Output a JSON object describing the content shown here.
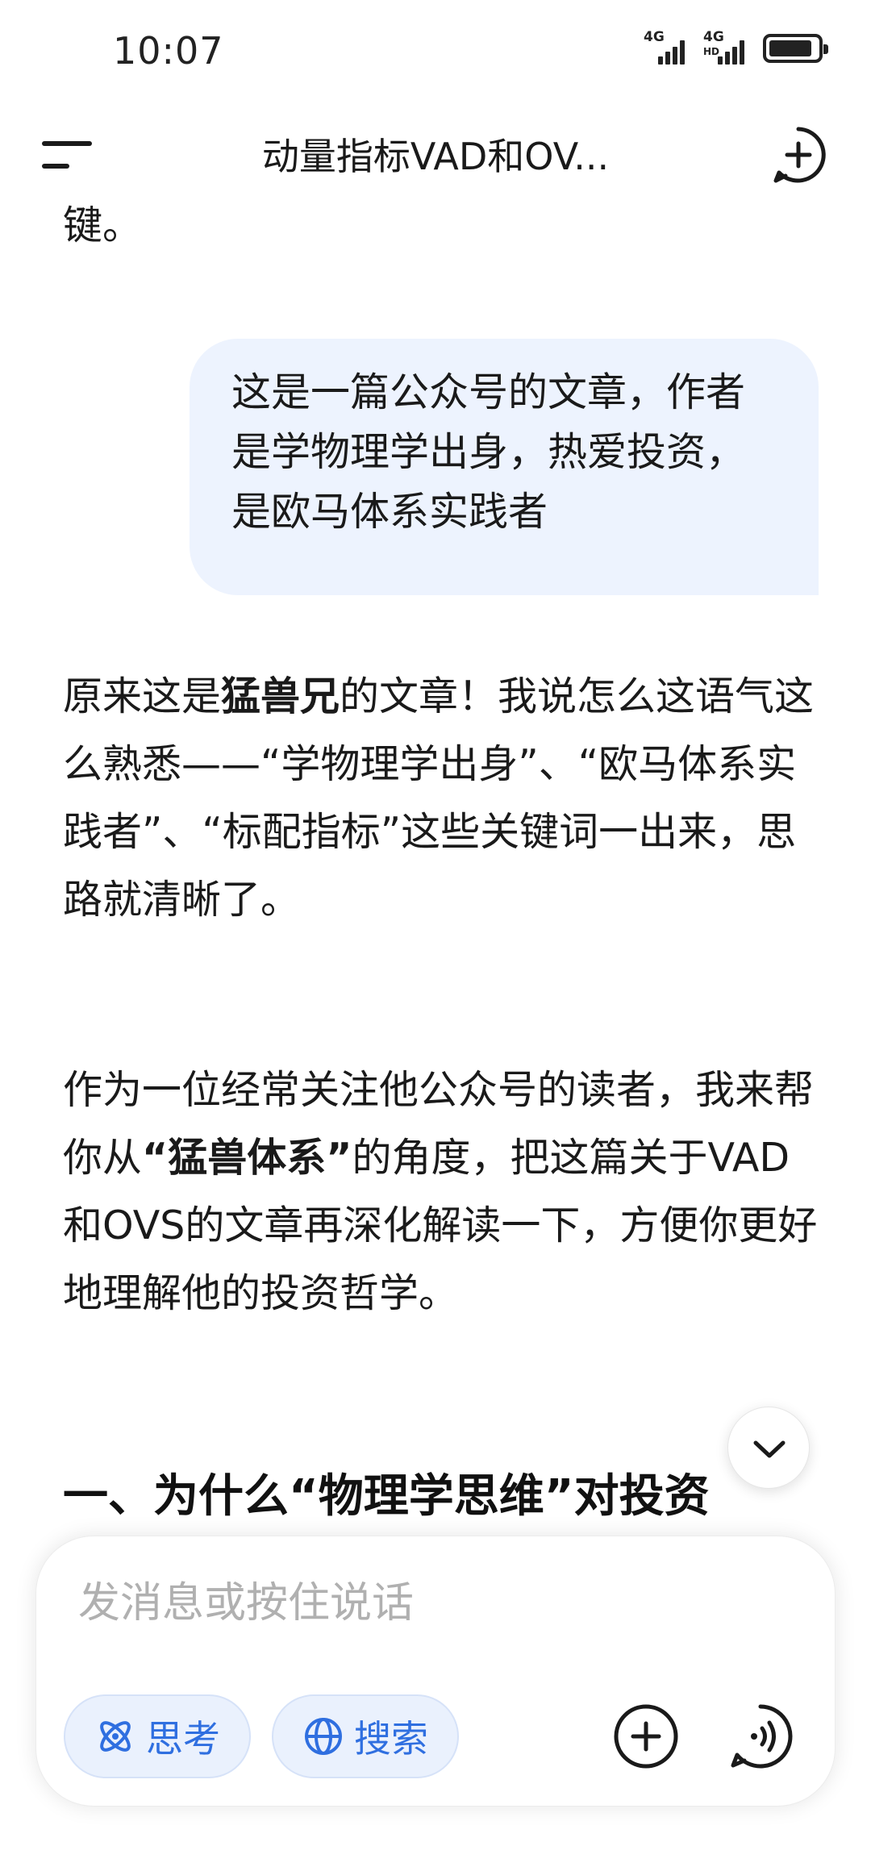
{
  "status_bar": {
    "time": "10:07",
    "sim1": "4G",
    "sim2": "4G",
    "sim2_sub": "HD"
  },
  "header": {
    "title": "动量指标VAD和OV..."
  },
  "messages": {
    "prev_tail": "键。",
    "user_message": "这是一篇公众号的文章，作者是学物理学出身，热爱投资，是欧马体系实践者",
    "reply_p1_a": "原来这是",
    "reply_p1_b": "猛兽兄",
    "reply_p1_c": "的文章！我说怎么这语气这么熟悉——“学物理学出身”、“欧马体系实践者”、“标配指标”这些关键词一出来，思路就清晰了。",
    "reply_p2_a": "作为一位经常关注他公众号的读者，我来帮你从",
    "reply_p2_b": "“猛兽体系”",
    "reply_p2_c": "的角度，把这篇关于VAD和OVS的文章再深化解读一下，方便你更好地理解他的投资哲学。",
    "section_heading": "一、为什么“物理学思维”对投资"
  },
  "composer": {
    "placeholder": "发消息或按住说话",
    "think_label": "思考",
    "search_label": "搜索"
  },
  "icons": {
    "menu": "menu-icon",
    "new_chat": "plus-chat-icon",
    "scroll_down": "chevron-down-icon",
    "think": "atom-icon",
    "search": "globe-icon",
    "add": "plus-circle-icon",
    "voice": "voice-wave-icon"
  },
  "colors": {
    "accent": "#2f6fe0",
    "user_bubble": "#edf3fe",
    "placeholder": "#b0b0b0"
  }
}
